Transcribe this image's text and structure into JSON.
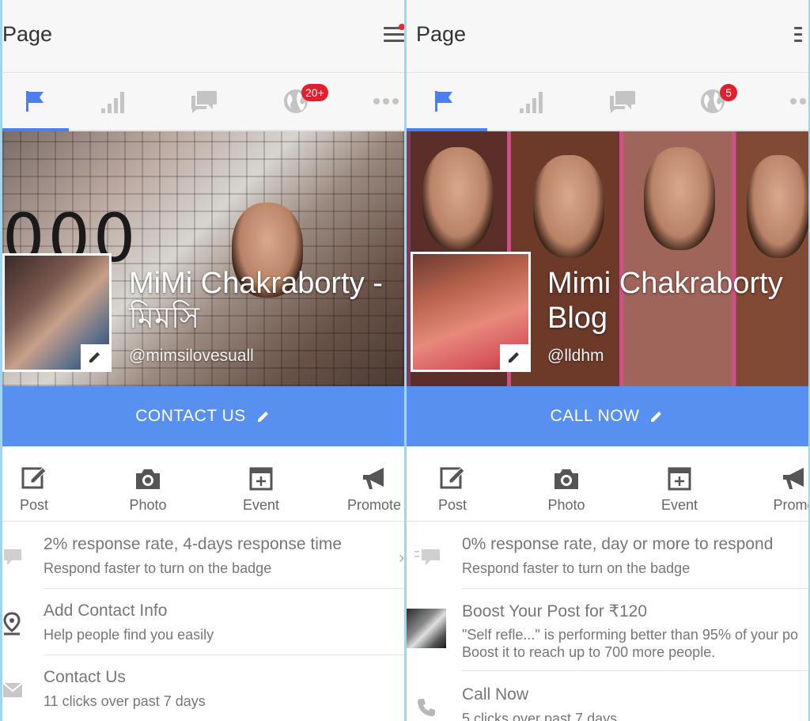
{
  "left": {
    "header": {
      "title": "Page"
    },
    "tabs": [
      {
        "icon": "flag-icon"
      },
      {
        "icon": "bar-chart-icon"
      },
      {
        "icon": "messages-icon"
      },
      {
        "icon": "globe-icon",
        "badge": "20+"
      },
      {
        "icon": "more-icon"
      }
    ],
    "cover": {
      "text": "000"
    },
    "page": {
      "name": "MiMi Chakraborty - মিমসি",
      "handle": "@mimsilovesuall"
    },
    "cta": {
      "label": "CONTACT US"
    },
    "actions": [
      {
        "label": "Post",
        "icon": "compose-icon"
      },
      {
        "label": "Photo",
        "icon": "camera-icon"
      },
      {
        "label": "Event",
        "icon": "calendar-add-icon"
      },
      {
        "label": "Promote",
        "icon": "megaphone-icon"
      }
    ],
    "rows": [
      {
        "icon": "chat-bubble-icon",
        "title": "2% response rate, 4-days response time",
        "subtitle": "Respond faster to turn on the badge"
      },
      {
        "icon": "location-pin-icon",
        "title": "Add Contact Info",
        "subtitle": "Help people find you easily"
      },
      {
        "icon": "envelope-icon",
        "title": "Contact Us",
        "subtitle": "11 clicks over past 7 days"
      }
    ]
  },
  "right": {
    "header": {
      "title": "Page"
    },
    "tabs": [
      {
        "icon": "flag-icon"
      },
      {
        "icon": "bar-chart-icon"
      },
      {
        "icon": "messages-icon"
      },
      {
        "icon": "globe-icon",
        "badge": "5"
      },
      {
        "icon": "more-icon"
      }
    ],
    "page": {
      "name": "Mimi Chakraborty Blog",
      "handle": "@lldhm"
    },
    "cta": {
      "label": "CALL NOW"
    },
    "actions": [
      {
        "label": "Post",
        "icon": "compose-icon"
      },
      {
        "label": "Photo",
        "icon": "camera-icon"
      },
      {
        "label": "Event",
        "icon": "calendar-add-icon"
      },
      {
        "label": "Promo",
        "icon": "megaphone-icon"
      }
    ],
    "rows": [
      {
        "icon": "chat-bubble-icon",
        "title": "0% response rate, day or more to respond",
        "subtitle": "Respond faster to turn on the badge"
      },
      {
        "icon": "post-thumbnail",
        "title": "Boost Your Post for ₹120",
        "subtitle": "\"Self refle...\" is performing better than 95% of your po",
        "subtitle2": "Boost it to reach up to 700 more people."
      },
      {
        "icon": "phone-icon",
        "title": "Call Now",
        "subtitle": "5 clicks over past 7 days"
      }
    ]
  },
  "colors": {
    "accent": "#5890f0",
    "tab_active": "#4c7ef0",
    "badge": "#e0202a",
    "text_muted": "#777777"
  }
}
